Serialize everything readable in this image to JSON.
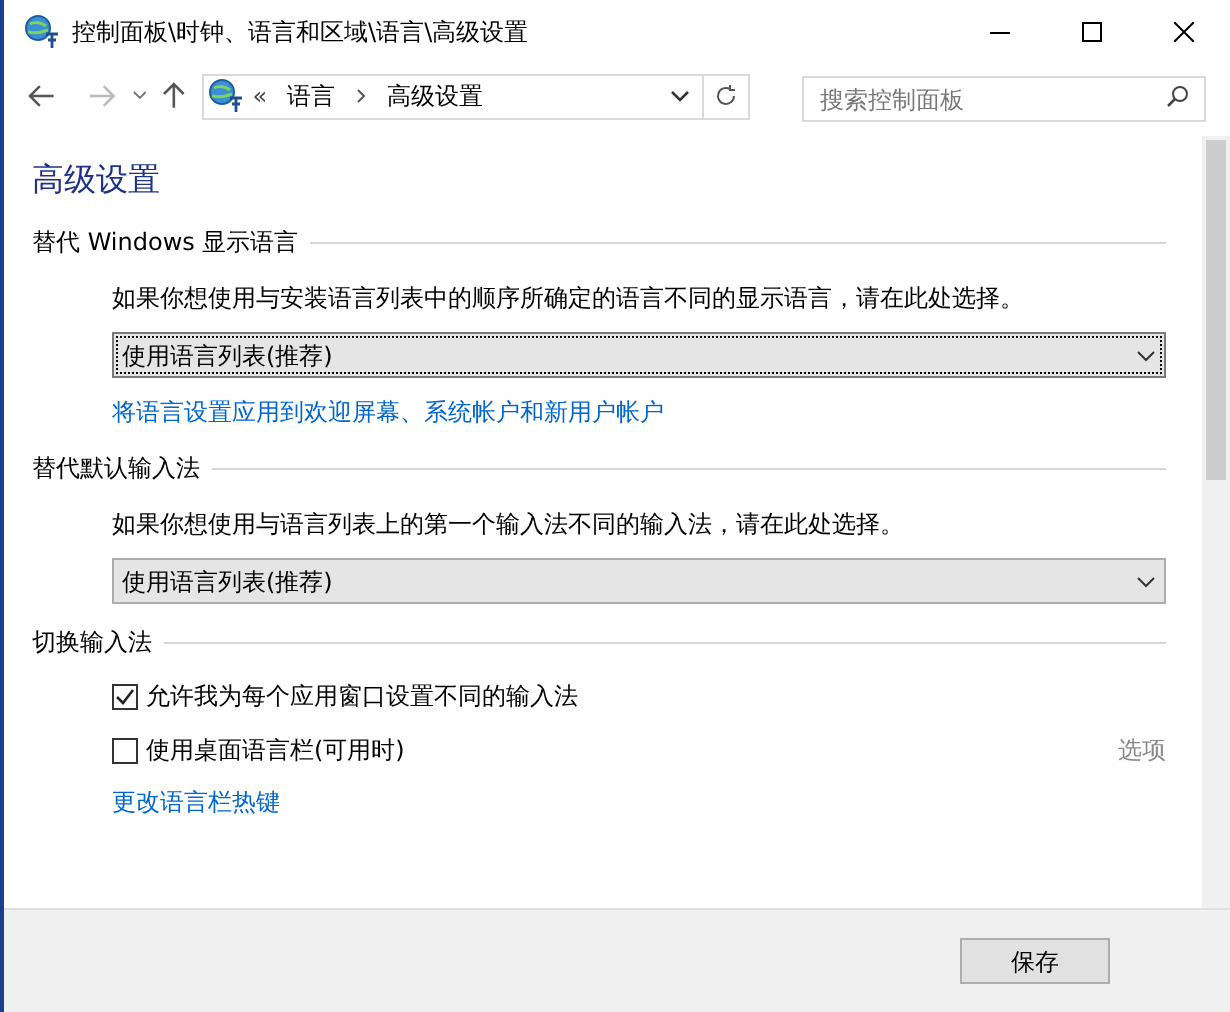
{
  "window": {
    "title": "控制面板\\时钟、语言和区域\\语言\\高级设置"
  },
  "address_bar": {
    "overflow": "«",
    "crumbs": [
      "语言",
      "高级设置"
    ]
  },
  "search": {
    "placeholder": "搜索控制面板"
  },
  "heading": "高级设置",
  "sections": [
    {
      "title": "替代 Windows 显示语言",
      "description": "如果你想使用与安装语言列表中的顺序所确定的语言不同的显示语言，请在此处选择。",
      "dropdown": {
        "value": "使用语言列表(推荐)",
        "focused": true
      },
      "link": "将语言设置应用到欢迎屏幕、系统帐户和新用户帐户"
    },
    {
      "title": "替代默认输入法",
      "description": "如果你想使用与语言列表上的第一个输入法不同的输入法，请在此处选择。",
      "dropdown": {
        "value": "使用语言列表(推荐)",
        "focused": false
      }
    },
    {
      "title": "切换输入法",
      "checkboxes": [
        {
          "label": "允许我为每个应用窗口设置不同的输入法",
          "checked": true
        },
        {
          "label": "使用桌面语言栏(可用时)",
          "checked": false,
          "option": {
            "label": "选项",
            "disabled": true
          }
        }
      ],
      "link": "更改语言栏热键"
    }
  ],
  "footer": {
    "buttons": [
      "保存"
    ]
  }
}
